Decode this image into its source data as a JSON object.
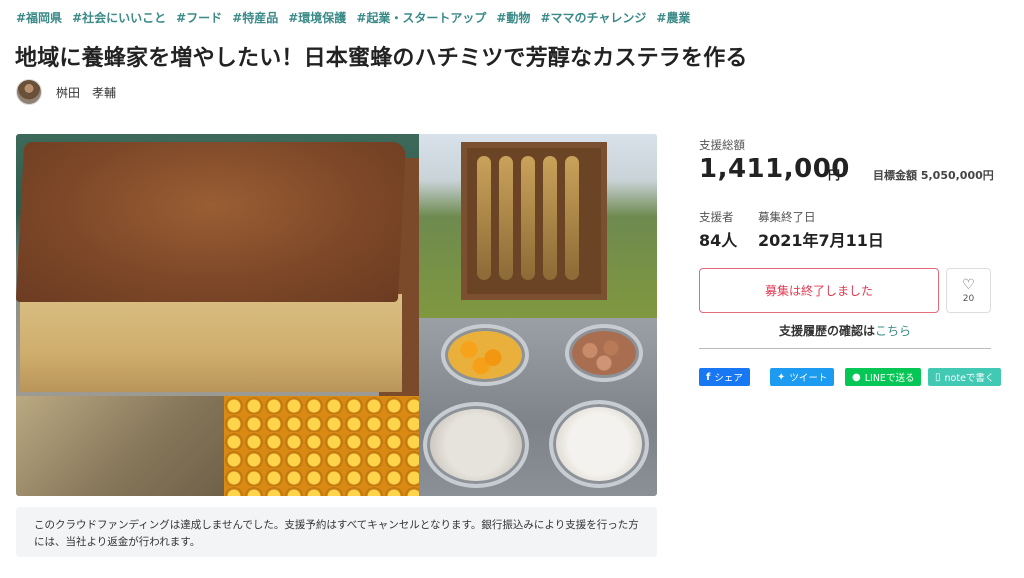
{
  "tags": [
    "#福岡県",
    "#社会にいいこと",
    "#フード",
    "#特産品",
    "#環境保護",
    "#起業・スタートアップ",
    "#動物",
    "#ママのチャレンジ",
    "#農業"
  ],
  "title": "地域に養蜂家を増やしたい！日本蜜蜂のハチミツで芳醇なカステラを作る",
  "owner": {
    "name": "桝田　孝輔"
  },
  "notice": "このクラウドファンディングは達成しませんでした。支援予約はすべてキャンセルとなります。銀行振込みにより支援を行った方には、当社より返金が行われます。",
  "panel": {
    "total_label": "支援総額",
    "total_value": "1,411,000",
    "total_unit": "円",
    "goal_text": "目標金額 5,050,000円",
    "supporters_label": "支援者",
    "supporters_value": "84人",
    "end_label": "募集終了日",
    "end_value": "2021年7月11日",
    "ended_button": "募集は終了しました",
    "favorite_count": "20",
    "history_text": "支援履歴の確認は",
    "history_link": "こちら"
  },
  "share": {
    "facebook": "シェア",
    "twitter": "ツイート",
    "line": "LINEで送る",
    "note": "noteで書く"
  },
  "icons": {
    "facebook": "facebook-icon",
    "twitter": "twitter-icon",
    "line": "line-icon",
    "note": "note-icon",
    "favorite": "heart-icon"
  }
}
